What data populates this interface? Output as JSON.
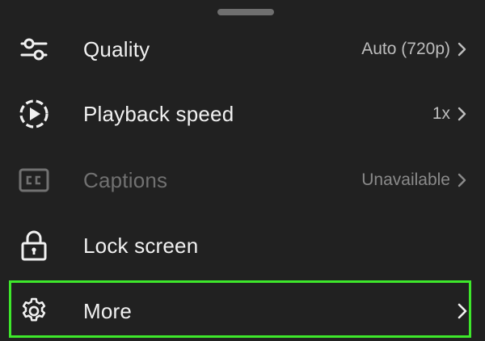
{
  "menu": {
    "items": [
      {
        "label": "Quality",
        "value": "Auto (720p)",
        "icon": "quality-sliders-icon",
        "enabled": true
      },
      {
        "label": "Playback speed",
        "value": "1x",
        "icon": "playback-speed-icon",
        "enabled": true
      },
      {
        "label": "Captions",
        "value": "Unavailable",
        "icon": "captions-cc-icon",
        "enabled": false
      },
      {
        "label": "Lock screen",
        "value": "",
        "icon": "lock-icon",
        "enabled": true
      },
      {
        "label": "More",
        "value": "",
        "icon": "gear-icon",
        "enabled": true
      }
    ]
  },
  "colors": {
    "background": "#212121",
    "text": "#f1f1f1",
    "secondary_text": "#bdbdbd",
    "disabled_text": "#717171",
    "highlight": "#3ee82b"
  }
}
